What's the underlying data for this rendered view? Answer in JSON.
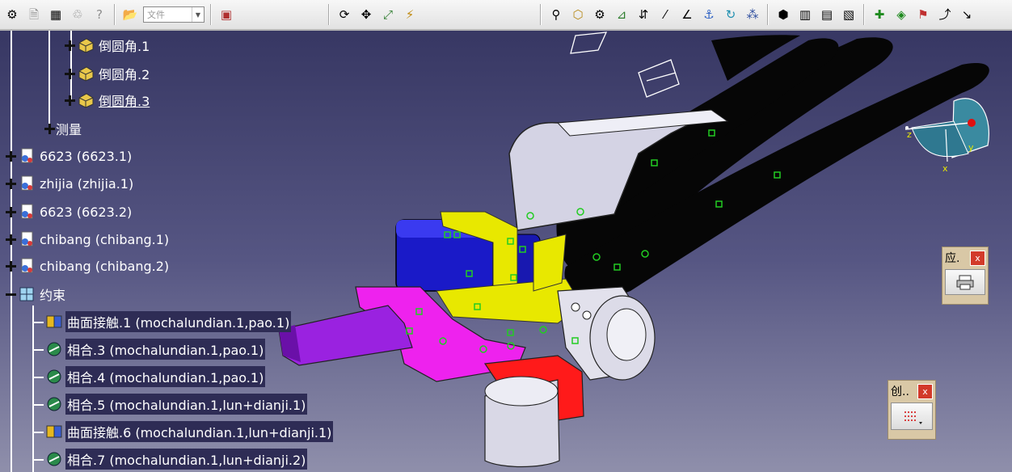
{
  "toolbar": {
    "file_placeholder": "文件"
  },
  "tree": {
    "items": [
      {
        "label": "倒圆角.1"
      },
      {
        "label": "倒圆角.2"
      },
      {
        "label": "倒圆角.3"
      },
      {
        "label": "测量"
      },
      {
        "label": "6623 (6623.1)"
      },
      {
        "label": "zhijia (zhijia.1)"
      },
      {
        "label": "6623 (6623.2)"
      },
      {
        "label": "chibang (chibang.1)"
      },
      {
        "label": "chibang (chibang.2)"
      },
      {
        "label": "约束"
      },
      {
        "label": "曲面接触.1 (mochalundian.1,pao.1)"
      },
      {
        "label": "相合.3 (mochalundian.1,pao.1)"
      },
      {
        "label": "相合.4 (mochalundian.1,pao.1)"
      },
      {
        "label": "相合.5 (mochalundian.1,lun+dianji.1)"
      },
      {
        "label": "曲面接触.6 (mochalundian.1,lun+dianji.1)"
      },
      {
        "label": "相合.7 (mochalundian.1,lun+dianji.2)"
      }
    ]
  },
  "compass": {
    "axis_x": "x",
    "axis_y": "y",
    "axis_z": "z"
  },
  "palettes": {
    "apply": {
      "title": "应.",
      "close": "x"
    },
    "create": {
      "title": "创..",
      "close": "x"
    }
  },
  "colors": {
    "background_top": "#33335f",
    "background_bottom": "#8f8fab",
    "tree_text": "#ffffff",
    "highlight": "#2e2c55"
  }
}
